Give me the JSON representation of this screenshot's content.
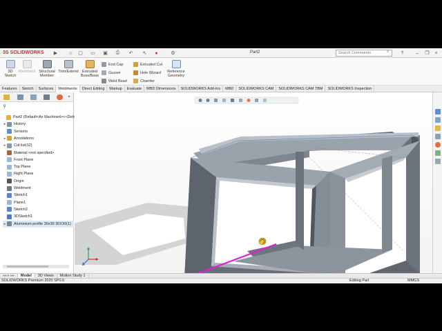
{
  "app": {
    "brand_ds": "3S",
    "brand_name": "SOLIDWORKS",
    "document_title": "Part2",
    "search_placeholder": "Search Commands"
  },
  "ribbon": {
    "big": [
      {
        "label": "3D\nSketch",
        "name": "3d-sketch"
      },
      {
        "label": "Weldment",
        "name": "weldment",
        "disabled": true
      },
      {
        "label": "Structural\nMember",
        "name": "structural-member"
      },
      {
        "label": "Trim/Extend",
        "name": "trim-extend"
      },
      {
        "label": "Extruded\nBoss/Base",
        "name": "extruded-boss"
      }
    ],
    "small_col1": [
      {
        "label": "End Cap",
        "name": "end-cap"
      },
      {
        "label": "Gusset",
        "name": "gusset"
      },
      {
        "label": "Weld Bead",
        "name": "weld-bead"
      }
    ],
    "small_col2": [
      {
        "label": "Extruded Cut",
        "name": "extruded-cut"
      },
      {
        "label": "Hole Wizard",
        "name": "hole-wizard"
      },
      {
        "label": "Chamfer",
        "name": "chamfer"
      }
    ],
    "reference": "Reference\nGeometry"
  },
  "tabs": [
    "Features",
    "Sketch",
    "Surfaces",
    "Weldments",
    "Direct Editing",
    "Markup",
    "Evaluate",
    "MBD Dimensions",
    "SOLIDWORKS Add-Ins",
    "MBD",
    "SOLIDWORKS CAM",
    "SOLIDWORKS CAM TBM",
    "SOLIDWORKS Inspection"
  ],
  "active_tab": "Weldments",
  "tree": [
    {
      "label": "Part2  (Default<As Machined><<Defa",
      "arrow": "",
      "icon": "part",
      "indent": 0
    },
    {
      "label": "History",
      "arrow": "▸",
      "icon": "history",
      "indent": 1
    },
    {
      "label": "Sensors",
      "arrow": "",
      "icon": "sensor",
      "indent": 1
    },
    {
      "label": "Annotations",
      "arrow": "▸",
      "icon": "annotation",
      "indent": 1
    },
    {
      "label": "Cut list(12)",
      "arrow": "▸",
      "icon": "cutlist",
      "indent": 1
    },
    {
      "label": "Material <not specified>",
      "arrow": "",
      "icon": "material",
      "indent": 1
    },
    {
      "label": "Front Plane",
      "arrow": "",
      "icon": "plane",
      "indent": 1
    },
    {
      "label": "Top Plane",
      "arrow": "",
      "icon": "plane",
      "indent": 1
    },
    {
      "label": "Right Plane",
      "arrow": "",
      "icon": "plane",
      "indent": 1
    },
    {
      "label": "Origin",
      "arrow": "",
      "icon": "origin",
      "indent": 1
    },
    {
      "label": "Weldment",
      "arrow": "",
      "icon": "weldment",
      "indent": 1
    },
    {
      "label": "Sketch1",
      "arrow": "",
      "icon": "sketch",
      "indent": 1
    },
    {
      "label": "Plane1",
      "arrow": "",
      "icon": "plane",
      "indent": 1
    },
    {
      "label": "Sketch2",
      "arrow": "",
      "icon": "sketch",
      "indent": 1
    },
    {
      "label": "3DSketch1",
      "arrow": "",
      "icon": "sketch3d",
      "indent": 1
    },
    {
      "label": "Aluminium profile 30x30 30X30(1)",
      "arrow": "▸",
      "icon": "structural",
      "indent": 1,
      "highlight": true
    }
  ],
  "bottom_tabs": [
    "Model",
    "3D Views",
    "Motion Study 1"
  ],
  "active_bottom_tab": "Model",
  "status": {
    "product": "SOLIDWORKS Premium 2020 SP0.0",
    "mode": "Editing Part",
    "units": "MMGS"
  },
  "colors": {
    "brand_red": "#d8262d",
    "selection_magenta": "#e01fd6",
    "frame_face": "#6f7780",
    "frame_light": "#aab1b9",
    "frame_dark": "#3e444b",
    "shadow": "#d2d2d2"
  }
}
